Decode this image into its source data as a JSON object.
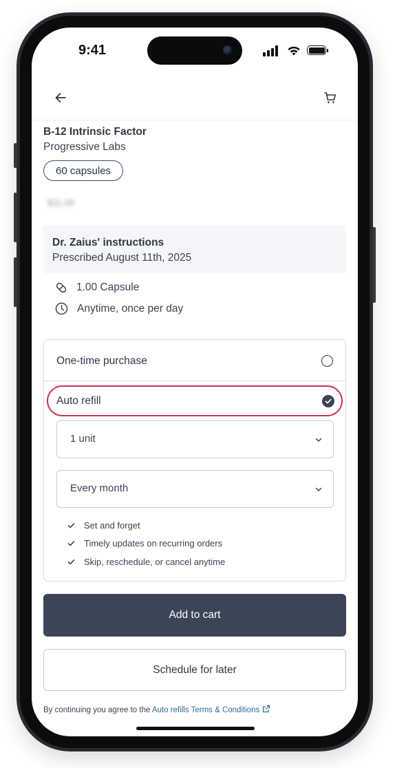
{
  "status_bar": {
    "time": "9:41"
  },
  "header": {
    "back_icon": "arrow-left-icon",
    "cart_icon": "shopping-cart-icon"
  },
  "product": {
    "name": "B-12 Intrinsic Factor",
    "brand": "Progressive Labs",
    "size_pill": "60 capsules",
    "price": "$11.09"
  },
  "instructions": {
    "title": "Dr. Zaius' instructions",
    "date": "Prescribed August 11th, 2025",
    "dose": "1.00 Capsule",
    "frequency": "Anytime, once per day",
    "dose_icon": "pill-icon",
    "frequency_icon": "clock-icon"
  },
  "purchase_options": {
    "one_time_label": "One-time purchase",
    "one_time_selected": false,
    "auto_refill_label": "Auto refill",
    "auto_refill_selected": true,
    "quantity_select": "1 unit",
    "frequency_select": "Every month",
    "benefits": [
      "Set and forget",
      "Timely updates on recurring orders",
      "Skip, reschedule, or cancel anytime"
    ]
  },
  "actions": {
    "add_to_cart": "Add to cart",
    "schedule_later": "Schedule for later"
  },
  "disclaimer": {
    "prefix": "By continuing you agree to the",
    "link": "Auto refills Terms & Conditions",
    "link_icon": "external-link-icon"
  },
  "colors": {
    "primary": "#3b4556",
    "highlight_ring": "#c8334f",
    "pill_border": "#2d4b6e",
    "link": "#2d6a8f"
  }
}
